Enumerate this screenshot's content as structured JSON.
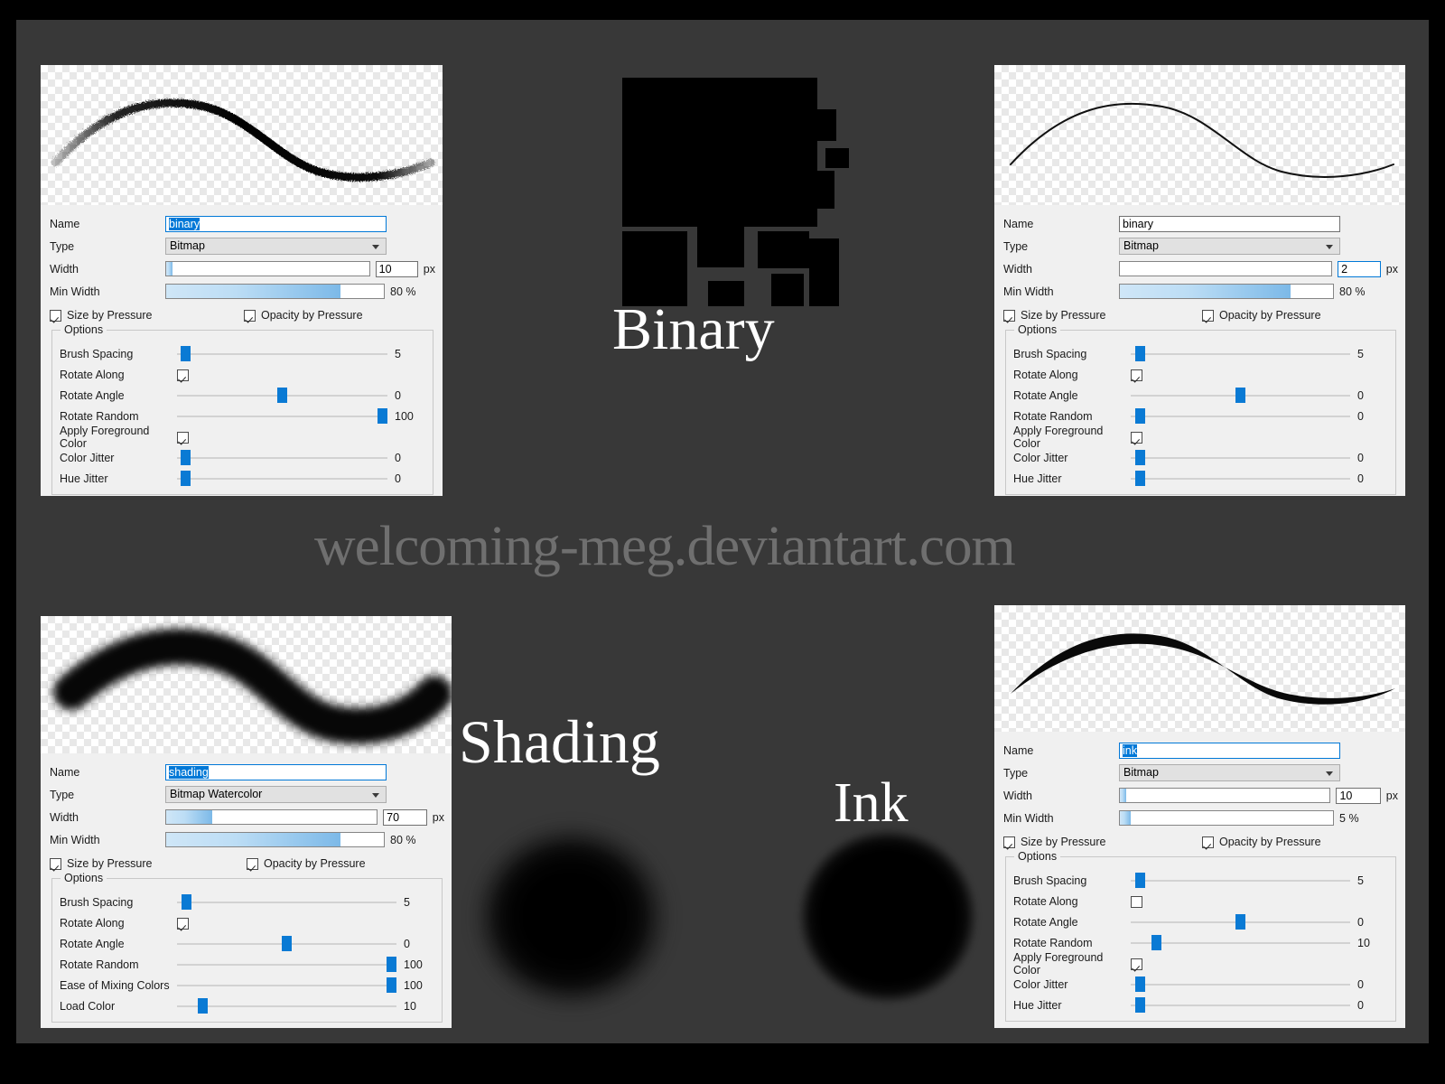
{
  "watermark": "welcoming-meg.deviantart.com",
  "titles": {
    "binary": "Binary",
    "shading": "Shading",
    "ink": "Ink"
  },
  "labels": {
    "name": "Name",
    "type": "Type",
    "width": "Width",
    "min_width": "Min Width",
    "size_by_pressure": "Size by Pressure",
    "opacity_by_pressure": "Opacity by Pressure",
    "options": "Options",
    "brush_spacing": "Brush Spacing",
    "rotate_along": "Rotate Along",
    "rotate_angle": "Rotate Angle",
    "rotate_random": "Rotate Random",
    "apply_foreground_color": "Apply Foreground Color",
    "color_jitter": "Color Jitter",
    "hue_jitter": "Hue Jitter",
    "ease_of_mixing_colors": "Ease of Mixing Colors",
    "load_color": "Load Color",
    "px": "px",
    "percent": "%"
  },
  "colors": {
    "accent": "#0a7ad4",
    "focus_border": "#0078d7",
    "selection": "#0078d7",
    "panel_bg": "#f0f0f0",
    "canvas_bg": "#383838",
    "frame": "#000000",
    "watermark": "#6f6f6f"
  },
  "panels": {
    "top_left": {
      "name_value": "binary",
      "name_selected": true,
      "name_focused": true,
      "type_value": "Bitmap",
      "width_value": "10",
      "width_unit": "px",
      "width_fill_pct": 3,
      "min_width_value": "80",
      "min_width_unit": "%",
      "min_width_fill_pct": 80,
      "size_by_pressure": true,
      "opacity_by_pressure": true,
      "options": [
        {
          "label": "Brush Spacing",
          "kind": "slider",
          "value": "5",
          "pos_pct": 2
        },
        {
          "label": "Rotate Along",
          "kind": "checkbox",
          "checked": true
        },
        {
          "label": "Rotate Angle",
          "kind": "slider",
          "value": "0",
          "pos_pct": 50
        },
        {
          "label": "Rotate Random",
          "kind": "slider",
          "value": "100",
          "pos_pct": 100
        },
        {
          "label": "Apply Foreground Color",
          "kind": "checkbox",
          "checked": true
        },
        {
          "label": "Color Jitter",
          "kind": "slider",
          "value": "0",
          "pos_pct": 2
        },
        {
          "label": "Hue Jitter",
          "kind": "slider",
          "value": "0",
          "pos_pct": 2
        }
      ]
    },
    "top_right": {
      "name_value": "binary",
      "name_selected": false,
      "name_focused": false,
      "type_value": "Bitmap",
      "width_value": "2",
      "width_unit": "px",
      "width_fill_pct": 0,
      "width_focused": true,
      "min_width_value": "80",
      "min_width_unit": "%",
      "min_width_fill_pct": 80,
      "size_by_pressure": true,
      "opacity_by_pressure": true,
      "options": [
        {
          "label": "Brush Spacing",
          "kind": "slider",
          "value": "5",
          "pos_pct": 2
        },
        {
          "label": "Rotate Along",
          "kind": "checkbox",
          "checked": true
        },
        {
          "label": "Rotate Angle",
          "kind": "slider",
          "value": "0",
          "pos_pct": 50
        },
        {
          "label": "Rotate Random",
          "kind": "slider",
          "value": "0",
          "pos_pct": 2
        },
        {
          "label": "Apply Foreground Color",
          "kind": "checkbox",
          "checked": true
        },
        {
          "label": "Color Jitter",
          "kind": "slider",
          "value": "0",
          "pos_pct": 2
        },
        {
          "label": "Hue Jitter",
          "kind": "slider",
          "value": "0",
          "pos_pct": 2
        }
      ]
    },
    "bottom_left": {
      "name_value": "shading",
      "name_selected": true,
      "name_focused": true,
      "type_value": "Bitmap Watercolor",
      "width_value": "70",
      "width_unit": "px",
      "width_fill_pct": 22,
      "min_width_value": "80",
      "min_width_unit": "%",
      "min_width_fill_pct": 80,
      "size_by_pressure": true,
      "opacity_by_pressure": true,
      "options": [
        {
          "label": "Brush Spacing",
          "kind": "slider",
          "value": "5",
          "pos_pct": 2
        },
        {
          "label": "Rotate Along",
          "kind": "checkbox",
          "checked": true
        },
        {
          "label": "Rotate Angle",
          "kind": "slider",
          "value": "0",
          "pos_pct": 50
        },
        {
          "label": "Rotate Random",
          "kind": "slider",
          "value": "100",
          "pos_pct": 100
        },
        {
          "label": "Ease of Mixing Colors",
          "kind": "slider",
          "value": "100",
          "pos_pct": 100
        },
        {
          "label": "Load Color",
          "kind": "slider",
          "value": "10",
          "pos_pct": 10
        }
      ]
    },
    "bottom_right": {
      "name_value": "ink",
      "name_selected": true,
      "name_focused": true,
      "type_value": "Bitmap",
      "width_value": "10",
      "width_unit": "px",
      "width_fill_pct": 3,
      "min_width_value": "5",
      "min_width_unit": "%",
      "min_width_fill_pct": 5,
      "size_by_pressure": true,
      "opacity_by_pressure": true,
      "options": [
        {
          "label": "Brush Spacing",
          "kind": "slider",
          "value": "5",
          "pos_pct": 2
        },
        {
          "label": "Rotate Along",
          "kind": "checkbox",
          "checked": false
        },
        {
          "label": "Rotate Angle",
          "kind": "slider",
          "value": "0",
          "pos_pct": 50
        },
        {
          "label": "Rotate Random",
          "kind": "slider",
          "value": "10",
          "pos_pct": 10
        },
        {
          "label": "Apply Foreground Color",
          "kind": "checkbox",
          "checked": true
        },
        {
          "label": "Color Jitter",
          "kind": "slider",
          "value": "0",
          "pos_pct": 2
        },
        {
          "label": "Hue Jitter",
          "kind": "slider",
          "value": "0",
          "pos_pct": 2
        }
      ]
    }
  }
}
